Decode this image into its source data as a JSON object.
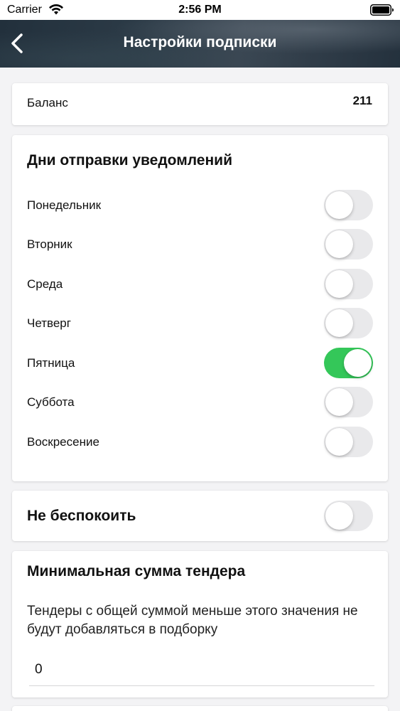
{
  "status_bar": {
    "carrier": "Carrier",
    "time": "2:56 PM"
  },
  "nav": {
    "title": "Настройки подписки",
    "back_icon": "chevron-left-icon"
  },
  "balance": {
    "label": "Баланс",
    "value": "211"
  },
  "days": {
    "title": "Дни отправки уведомлений",
    "items": [
      {
        "label": "Понедельник",
        "enabled": false
      },
      {
        "label": "Вторник",
        "enabled": false
      },
      {
        "label": "Среда",
        "enabled": false
      },
      {
        "label": "Четверг",
        "enabled": false
      },
      {
        "label": "Пятница",
        "enabled": true
      },
      {
        "label": "Суббота",
        "enabled": false
      },
      {
        "label": "Воскресение",
        "enabled": false
      }
    ]
  },
  "do_not_disturb": {
    "label": "Не беспокоить",
    "enabled": false
  },
  "min_sum": {
    "title": "Минимальная сумма тендера",
    "description": "Тендеры с общей суммой меньше этого значения не будут добавляться в подборку",
    "value": "0"
  },
  "colors": {
    "toggle_on": "#34c759",
    "toggle_off": "#e9e9eb",
    "background": "#f3f3f5"
  }
}
